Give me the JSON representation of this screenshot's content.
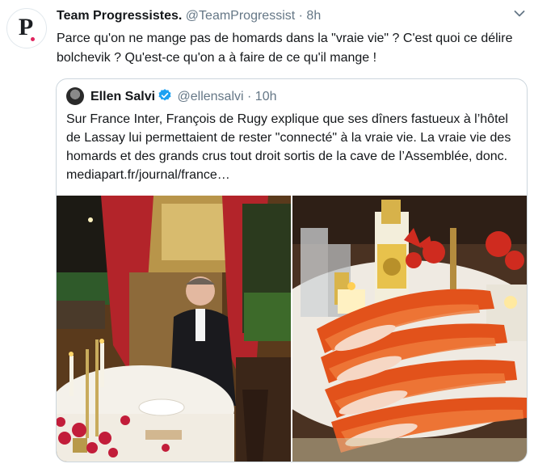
{
  "tweet": {
    "author_name": "Team Progressistes.",
    "handle": "@TeamProgressist",
    "separator": "·",
    "time": "8h",
    "avatar_letter": "P",
    "text": "Parce qu'on ne mange pas de homards dans la \"vraie vie\" ? C'est quoi ce délire bolchevik ? Qu'est-ce qu'on a à faire de ce qu'il mange !"
  },
  "quoted_tweet": {
    "author_name": "Ellen Salvi",
    "handle": "@ellensalvi",
    "separator": "·",
    "time": "10h",
    "text": "Sur France Inter, François de Rugy explique que ses dîners fastueux à l’hôtel de Lassay lui permettaient de rester \"connecté\" à la vraie vie. La vraie vie des homards et des grands crus tout droit sortis de la cave de l’Assemblée, donc. mediapart.fr/journal/france…"
  },
  "icons": [
    "chevron-down-icon",
    "verified-badge-icon"
  ],
  "colors": {
    "text": "#14171a",
    "secondary": "#657786",
    "border": "#ccd6dd",
    "verified": "#1da1f2",
    "avatar_accent": "#e0245e"
  }
}
